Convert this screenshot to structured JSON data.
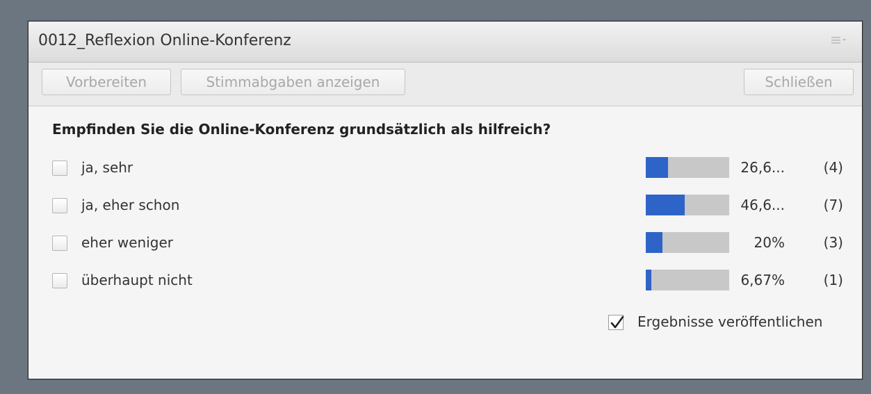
{
  "pod": {
    "title": "0012_Reflexion Online-Konferenz",
    "menu_icon": "pod-options-icon"
  },
  "toolbar": {
    "prepare_label": "Vorbereiten",
    "show_votes_label": "Stimmabgaben anzeigen",
    "close_label": "Schließen"
  },
  "poll": {
    "question": "Empfinden Sie die Online-Konferenz grundsätzlich als hilfreich?",
    "options": [
      {
        "label": "ja, sehr",
        "percent_text": "26,6...",
        "count_text": "(4)",
        "fraction": 0.267
      },
      {
        "label": "ja, eher schon",
        "percent_text": "46,6...",
        "count_text": "(7)",
        "fraction": 0.467
      },
      {
        "label": "eher weniger",
        "percent_text": "20%",
        "count_text": "(3)",
        "fraction": 0.2
      },
      {
        "label": "überhaupt nicht",
        "percent_text": "6,67%",
        "count_text": "(1)",
        "fraction": 0.0667
      }
    ],
    "publish_label": "Ergebnisse veröffentlichen",
    "publish_checked": true
  },
  "colors": {
    "bar_fill": "#2e64c8",
    "bar_track": "#c8c8c8"
  }
}
